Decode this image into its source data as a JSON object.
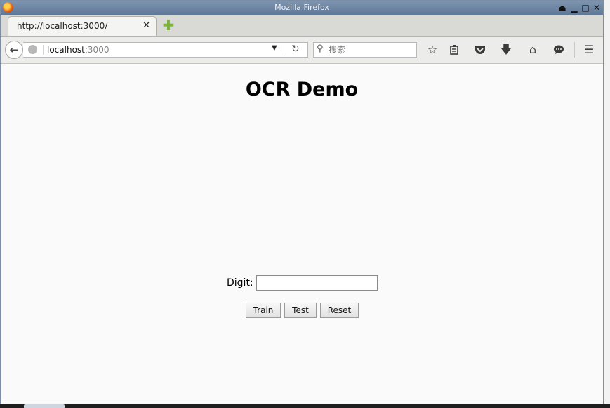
{
  "window": {
    "title": "Mozilla Firefox"
  },
  "tab": {
    "title": "http://localhost:3000/"
  },
  "urlbar": {
    "host": "localhost",
    "port": ":3000"
  },
  "search": {
    "placeholder": "搜索"
  },
  "toolbar_icons": [
    "star-icon",
    "reading-list-icon",
    "pocket-icon",
    "download-icon",
    "home-icon",
    "chat-icon",
    "menu-icon"
  ],
  "page": {
    "heading": "OCR Demo",
    "digit_label": "Digit:",
    "digit_value": "",
    "buttons": {
      "train": "Train",
      "test": "Test",
      "reset": "Reset"
    }
  }
}
